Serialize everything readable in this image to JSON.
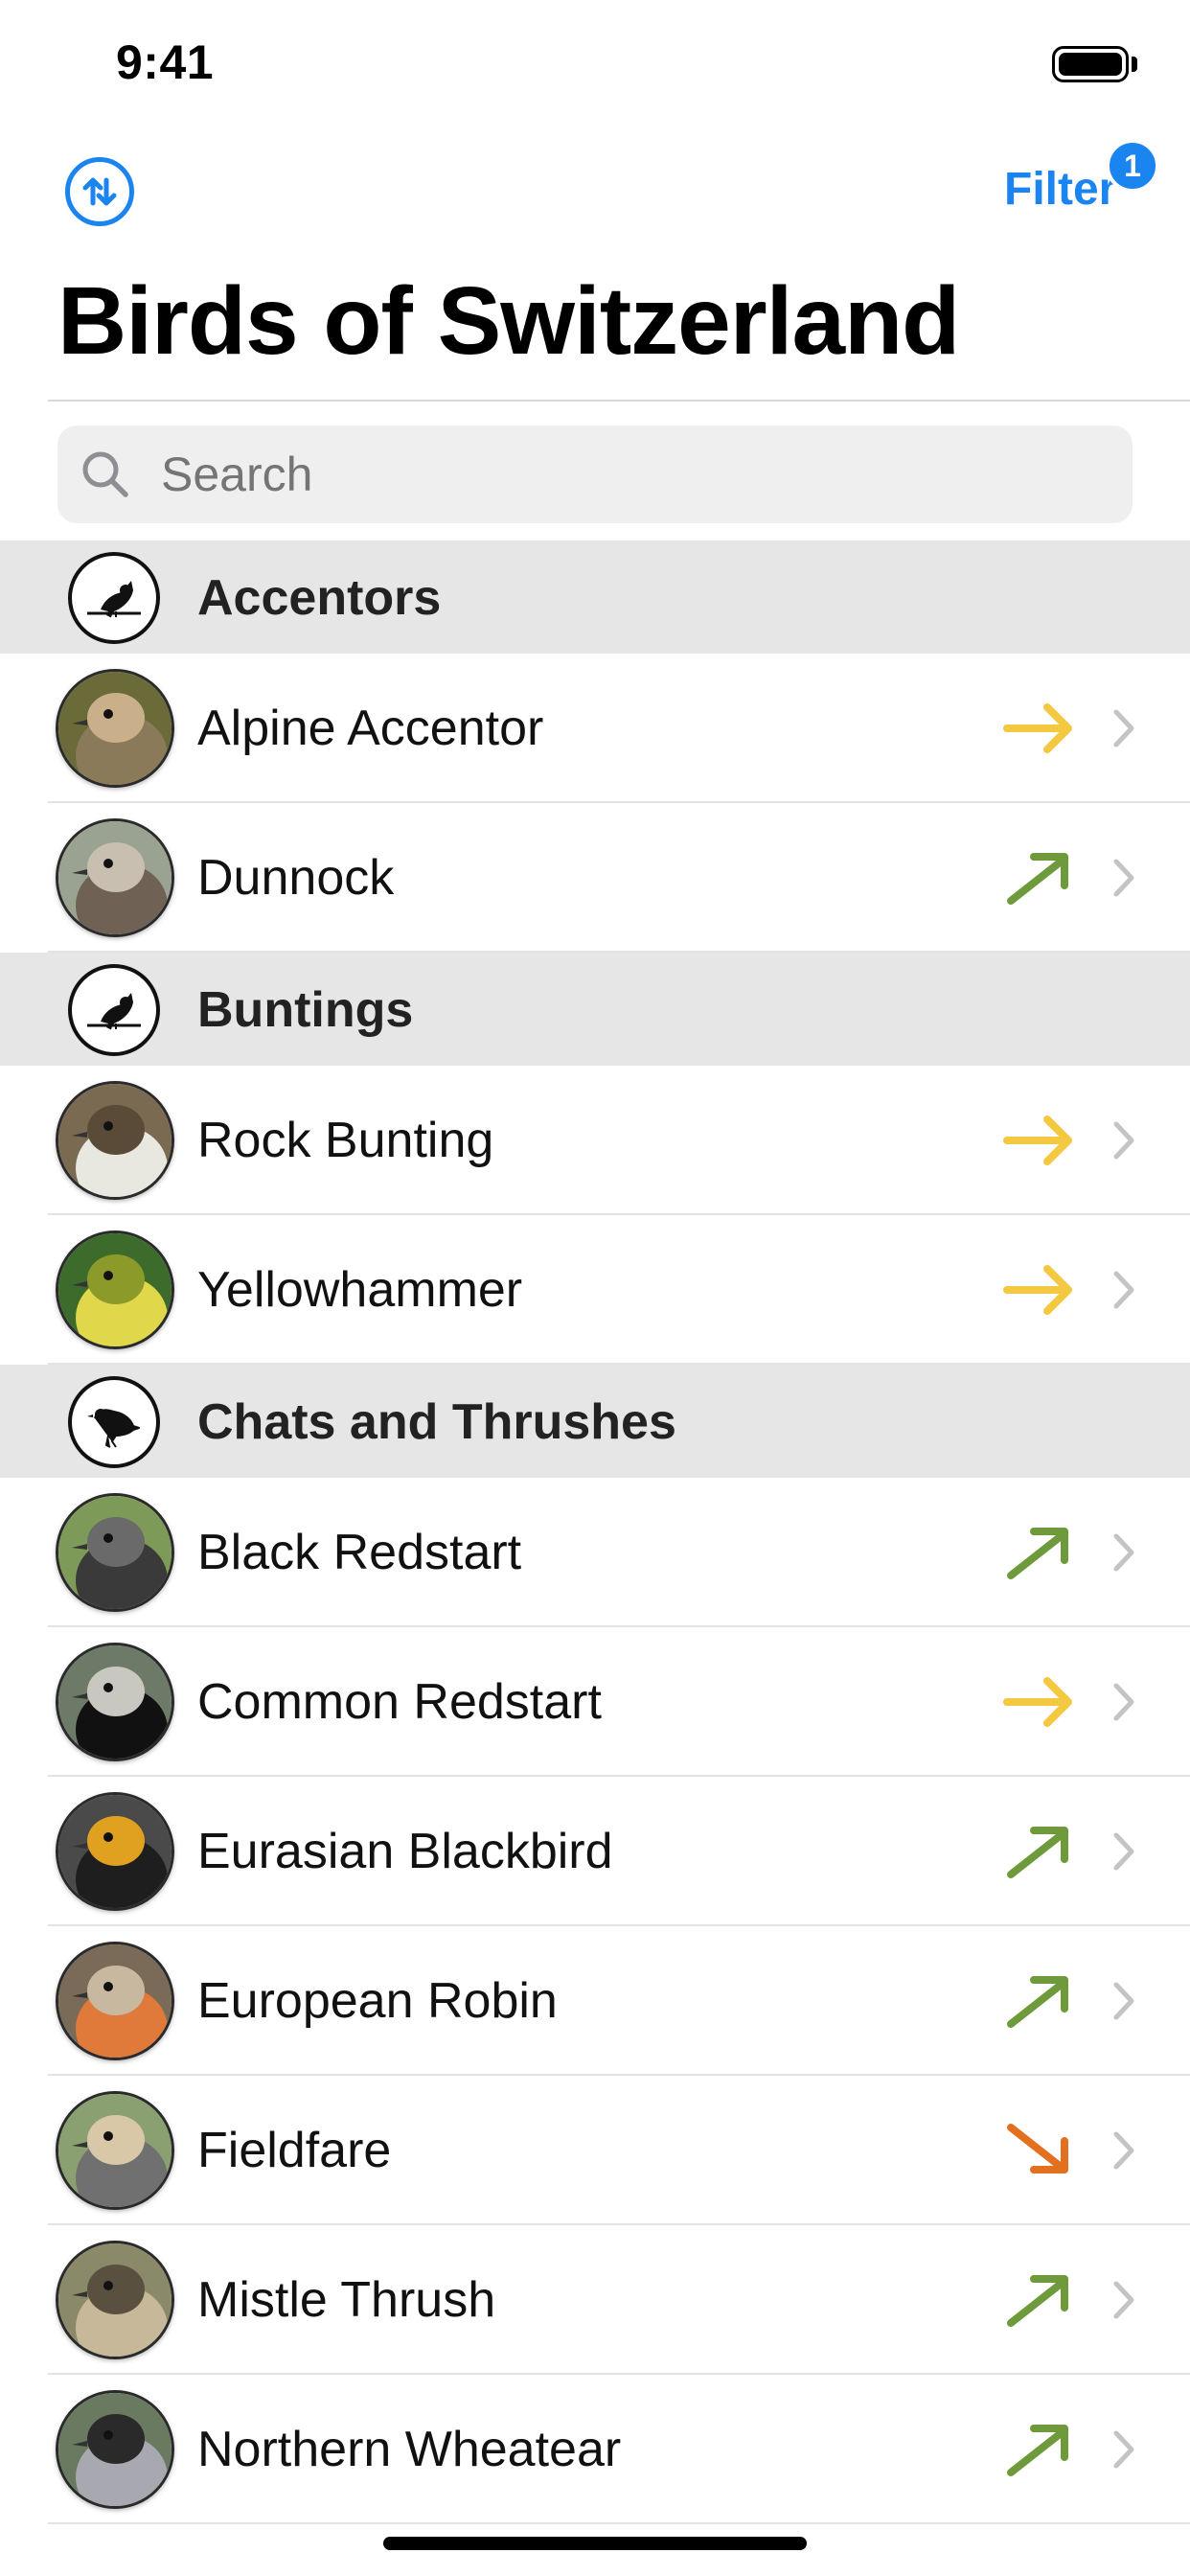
{
  "status_bar": {
    "time": "9:41"
  },
  "nav": {
    "sort_icon": "arrows-up-down-circle-icon",
    "filter_label": "Filter",
    "filter_badge": "1"
  },
  "page_title": "Birds of Switzerland",
  "search": {
    "placeholder": "Search"
  },
  "colors": {
    "accent": "#1a84f0",
    "trend_stable": "#f5c842",
    "trend_increasing": "#6f9a3c",
    "trend_decreasing": "#e2701f"
  },
  "sections": [
    {
      "title": "Accentors",
      "icon": "perched-bird-silhouette-icon",
      "birds": [
        {
          "name": "Alpine Accentor",
          "trend": "stable",
          "trend_icon": "arrow-right-icon"
        },
        {
          "name": "Dunnock",
          "trend": "increasing",
          "trend_icon": "arrow-up-right-icon"
        }
      ]
    },
    {
      "title": "Buntings",
      "icon": "perched-bird-silhouette-icon",
      "birds": [
        {
          "name": "Rock Bunting",
          "trend": "stable",
          "trend_icon": "arrow-right-icon"
        },
        {
          "name": "Yellowhammer",
          "trend": "stable",
          "trend_icon": "arrow-right-icon"
        }
      ]
    },
    {
      "title": "Chats and Thrushes",
      "icon": "thrush-silhouette-icon",
      "birds": [
        {
          "name": "Black Redstart",
          "trend": "increasing",
          "trend_icon": "arrow-up-right-icon"
        },
        {
          "name": "Common Redstart",
          "trend": "stable",
          "trend_icon": "arrow-right-icon"
        },
        {
          "name": "Eurasian Blackbird",
          "trend": "increasing",
          "trend_icon": "arrow-up-right-icon"
        },
        {
          "name": "European Robin",
          "trend": "increasing",
          "trend_icon": "arrow-up-right-icon"
        },
        {
          "name": "Fieldfare",
          "trend": "decreasing",
          "trend_icon": "arrow-down-right-icon"
        },
        {
          "name": "Mistle Thrush",
          "trend": "increasing",
          "trend_icon": "arrow-up-right-icon"
        },
        {
          "name": "Northern Wheatear",
          "trend": "increasing",
          "trend_icon": "arrow-up-right-icon"
        }
      ]
    }
  ]
}
